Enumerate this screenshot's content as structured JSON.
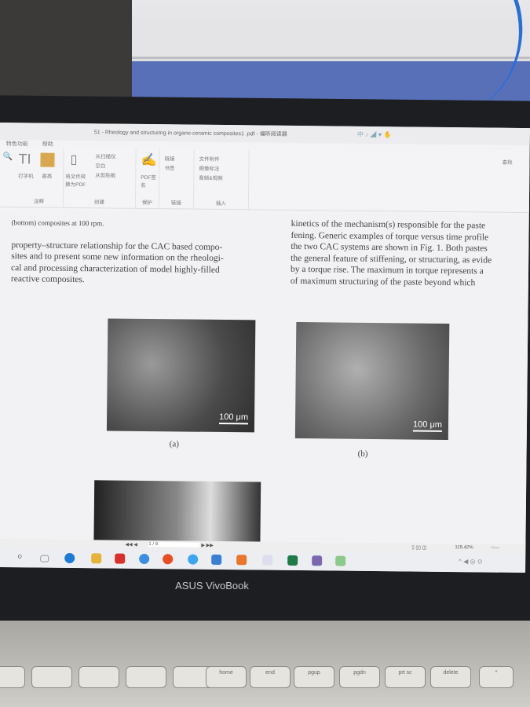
{
  "window": {
    "title": "51 - Rheology and structuring in organo-ceramic composites1 .pdf - 福昕阅读器",
    "menu": [
      "特色功能",
      "帮助"
    ]
  },
  "ribbon": {
    "groups": [
      {
        "label": "注释",
        "items": [
          "打字机",
          "高亮"
        ]
      },
      {
        "label": "创建",
        "items": [
          "将文件转换为PDF",
          "从扫描仪",
          "空白",
          "从剪贴板"
        ]
      },
      {
        "label": "保护",
        "items": [
          "PDF签名"
        ]
      },
      {
        "label": "链接",
        "items": [
          "链接",
          "书签"
        ]
      },
      {
        "label": "插入",
        "items": [
          "文件附件",
          "图像标注",
          "音频&视频"
        ]
      }
    ],
    "right_item": "查找"
  },
  "document": {
    "left_caption_tail": "(bottom) composites at 100 rpm.",
    "left_paragraph": [
      "property–structure relationship for the CAC based compo-",
      "sites and to present some new information on the rheologi-",
      "cal and processing characterization of model highly-filled",
      "reactive composites."
    ],
    "right_paragraph": [
      "kinetics of the mechanism(s) responsible for the paste",
      "fening. Generic examples of torque versus time profile",
      "the two CAC systems are shown in Fig. 1. Both pastes",
      "the general feature of stiffening, or structuring, as evide",
      "by a torque rise. The maximum in torque represents a",
      "of maximum structuring of the paste beyond which"
    ],
    "figures": [
      {
        "label": "(a)",
        "scale": "100 μm"
      },
      {
        "label": "(b)",
        "scale": "100 μm"
      }
    ]
  },
  "nav": {
    "page": "1 / 9",
    "zoom": "115.42%"
  },
  "laptop": {
    "brand": "ASUS VivoBook",
    "keys": [
      "",
      "",
      "",
      "",
      "home",
      "end",
      "pgup",
      "pgdn",
      "prt sc",
      "delete",
      "*"
    ]
  }
}
